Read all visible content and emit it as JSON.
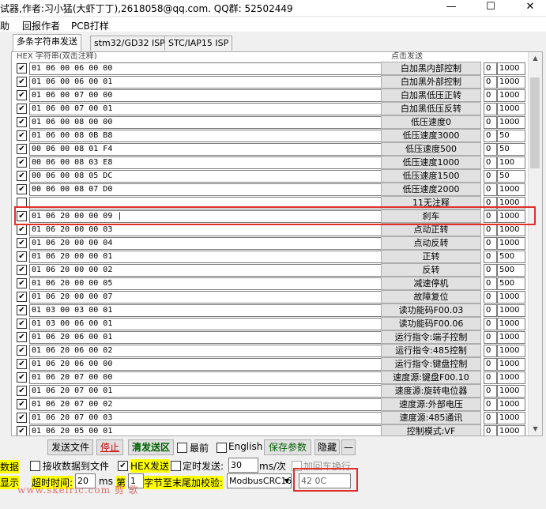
{
  "window": {
    "title": "试器,作者:习小猛(大虾丁丁),2618058@qq.com. QQ群: 52502449",
    "minimize": "—",
    "maximize": "☐",
    "close": "✕"
  },
  "menu": [
    "助",
    "回报作者",
    "PCB打样"
  ],
  "tabs": [
    "多条字符串发送",
    "stm32/GD32 ISP",
    "STC/IAP15 ISP"
  ],
  "list_header": "HEX 字符串(双击注释)",
  "list_header_right": "点击发送",
  "rows": [
    {
      "checked": true,
      "hex": "01 06 00 06 00 00",
      "label": "白加黑内部控制",
      "num": "0",
      "delay": "1000"
    },
    {
      "checked": true,
      "hex": "01 06 00 06 00 01",
      "label": "白加黑外部控制",
      "num": "0",
      "delay": "1000"
    },
    {
      "checked": true,
      "hex": "01 06 00 07 00 00",
      "label": "白加黑低压正转",
      "num": "0",
      "delay": "1000"
    },
    {
      "checked": true,
      "hex": "01 06 00 07 00 01",
      "label": "白加黑低压反转",
      "num": "0",
      "delay": "1000"
    },
    {
      "checked": true,
      "hex": "01 06 00 08 00 00",
      "label": "低压速度0",
      "num": "0",
      "delay": "1000"
    },
    {
      "checked": true,
      "hex": "01 06 00 08 0B B8",
      "label": "低压速度3000",
      "num": "0",
      "delay": "50"
    },
    {
      "checked": true,
      "hex": "00 06 00 08 01 F4",
      "label": "低压速度500",
      "num": "0",
      "delay": "50"
    },
    {
      "checked": true,
      "hex": "00 06 00 08 03 E8",
      "label": "低压速度1000",
      "num": "0",
      "delay": "100"
    },
    {
      "checked": true,
      "hex": "00 06 00 08 05 DC",
      "label": "低压速度1500",
      "num": "0",
      "delay": "50"
    },
    {
      "checked": true,
      "hex": "00 06 00 08 07 D0",
      "label": "低压速度2000",
      "num": "0",
      "delay": "1000"
    },
    {
      "checked": false,
      "hex": "",
      "label": "11无注释",
      "num": "0",
      "delay": "1000"
    },
    {
      "checked": true,
      "hex": "01 06 20 00 00 09 |",
      "label": "刹车",
      "num": "0",
      "delay": "1000"
    },
    {
      "checked": true,
      "hex": "01 06 20 00 00 03",
      "label": "点动正转",
      "num": "0",
      "delay": "1000"
    },
    {
      "checked": true,
      "hex": "01 06 20 00 00 04",
      "label": "点动反转",
      "num": "0",
      "delay": "1000"
    },
    {
      "checked": true,
      "hex": "01 06 20 00 00 01",
      "label": "正转",
      "num": "0",
      "delay": "500"
    },
    {
      "checked": true,
      "hex": "01 06 20 00 00 02",
      "label": "反转",
      "num": "0",
      "delay": "500"
    },
    {
      "checked": true,
      "hex": "01 06 20 00 00 05",
      "label": "减速停机",
      "num": "0",
      "delay": "500"
    },
    {
      "checked": true,
      "hex": "01 06 20 00 00 07",
      "label": "故障复位",
      "num": "0",
      "delay": "1000"
    },
    {
      "checked": true,
      "hex": "01 03 00 03 00 01",
      "label": "读功能码F00.03",
      "num": "0",
      "delay": "1000"
    },
    {
      "checked": true,
      "hex": "01 03 00 06 00 01",
      "label": "读功能码F00.06",
      "num": "0",
      "delay": "1000"
    },
    {
      "checked": true,
      "hex": "01 06 20 06 00 01",
      "label": "运行指令:端子控制",
      "num": "0",
      "delay": "1000"
    },
    {
      "checked": true,
      "hex": "01 06 20 06 00 02",
      "label": "运行指令:485控制",
      "num": "0",
      "delay": "1000"
    },
    {
      "checked": true,
      "hex": "01 06 20 06 00 00",
      "label": "运行指令:键盘控制",
      "num": "0",
      "delay": "1000"
    },
    {
      "checked": true,
      "hex": "01 06 20 07 00 00",
      "label": "速度源:键盘F00.10",
      "num": "0",
      "delay": "1000"
    },
    {
      "checked": true,
      "hex": "01 06 20 07 00 01",
      "label": "速度源:旋转电位器",
      "num": "0",
      "delay": "1000"
    },
    {
      "checked": true,
      "hex": "01 06 20 07 00 02",
      "label": "速度源:外部电压",
      "num": "0",
      "delay": "1000"
    },
    {
      "checked": true,
      "hex": "01 06 20 07 00 03",
      "label": "速度源:485通讯",
      "num": "0",
      "delay": "1000"
    },
    {
      "checked": true,
      "hex": "01 06 20 05 00 01",
      "label": "控制模式:VF",
      "num": "0",
      "delay": "1000"
    }
  ],
  "bottom": {
    "send_file": "发送文件",
    "stop": "停止",
    "clear_send": "清发送区",
    "last_label": "最前",
    "english_label": "English",
    "save_params": "保存参数",
    "hide": "隐藏",
    "dash": "—",
    "data_label": "数据",
    "recv_to_file": "接收数据到文件",
    "hex_send": "HEX发送",
    "timed_send": "定时发送:",
    "interval": "30",
    "ms_per": "ms/次",
    "add_newline": "加回车换行",
    "show_label": "显示",
    "timeout_label": "超时时间:",
    "timeout_value": "20",
    "ms": "ms",
    "nth_label": "第",
    "nth_value": "1",
    "byte_label": "字节至末尾加校验:",
    "checksum_type": "ModbusCRC16",
    "checksum_value": "42 0C"
  },
  "watermark": "www.skelric.com 剪 歌"
}
